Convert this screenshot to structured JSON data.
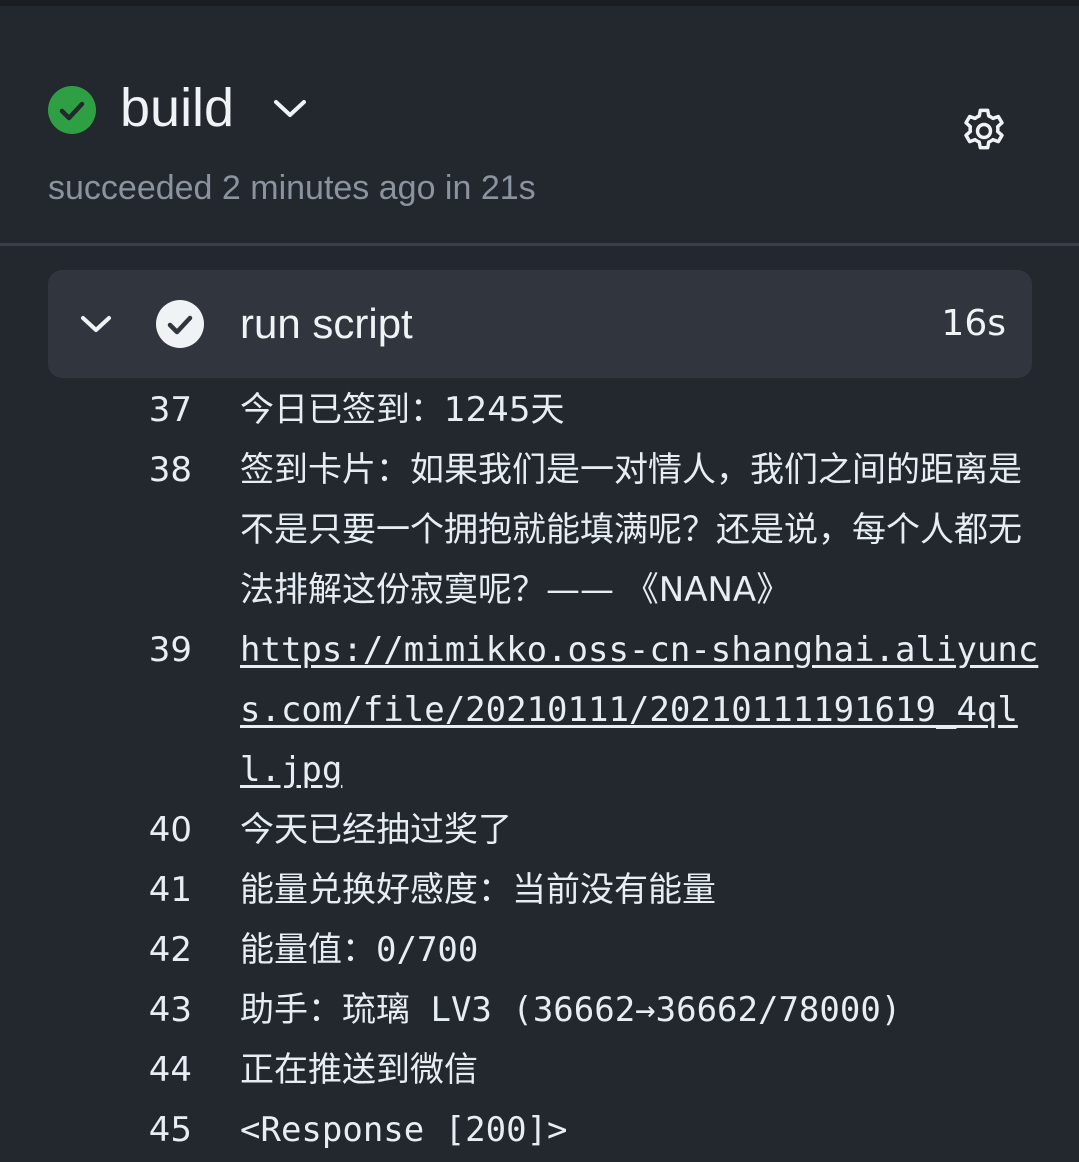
{
  "job": {
    "title": "build",
    "subtitle": "succeeded 2 minutes ago in 21s",
    "status_color": "#2ea043"
  },
  "step": {
    "label": "run script",
    "duration": "16s"
  },
  "log": {
    "lines": [
      {
        "num": "37",
        "text": "今日已签到：1245天"
      },
      {
        "num": "38",
        "text": "签到卡片：如果我们是一对情人，我们之间的距离是不是只要一个拥抱就能填满呢？还是说，每个人都无法排解这份寂寞呢？—— 《NANA》"
      },
      {
        "num": "39",
        "text": "https://mimikko.oss-cn-shanghai.aliyuncs.com/file/20210111/20210111191619_4qll.jpg"
      },
      {
        "num": "40",
        "text": "今天已经抽过奖了"
      },
      {
        "num": "41",
        "text": "能量兑换好感度：当前没有能量"
      },
      {
        "num": "42",
        "text": "能量值：0/700"
      },
      {
        "num": "43",
        "text": "助手：琉璃 LV3 (36662→36662/78000)"
      },
      {
        "num": "44",
        "text": "正在推送到微信"
      },
      {
        "num": "45",
        "text": "<Response [200]>"
      }
    ]
  }
}
